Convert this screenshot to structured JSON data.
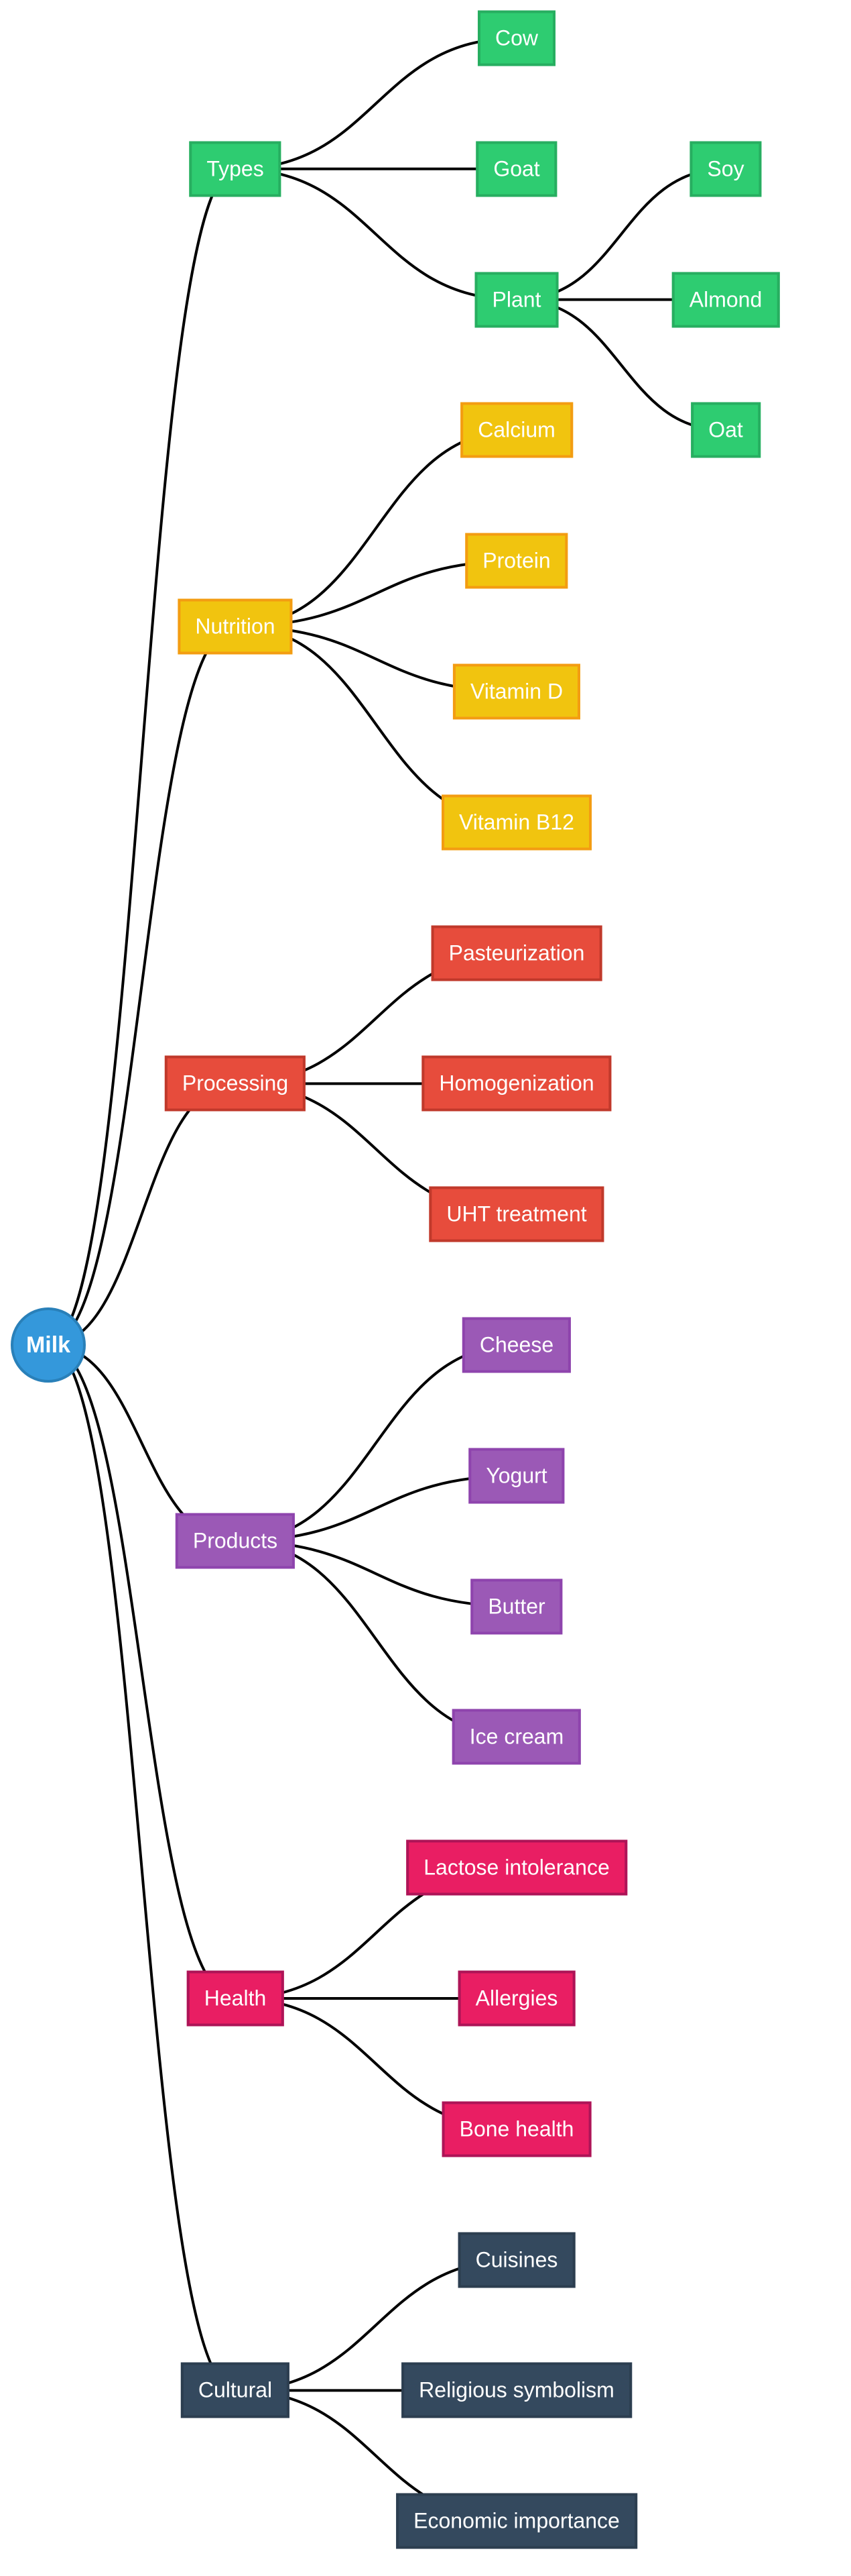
{
  "diagram": {
    "type": "mindmap",
    "root": {
      "label": "Milk",
      "color": {
        "fill": "#3498db",
        "border": "#2980b9"
      },
      "children": [
        {
          "label": "Types",
          "color": {
            "fill": "#2ecc71",
            "border": "#27ae60"
          },
          "children": [
            {
              "label": "Cow"
            },
            {
              "label": "Goat"
            },
            {
              "label": "Plant",
              "children": [
                {
                  "label": "Soy"
                },
                {
                  "label": "Almond"
                },
                {
                  "label": "Oat"
                }
              ]
            }
          ]
        },
        {
          "label": "Nutrition",
          "color": {
            "fill": "#f1c40f",
            "border": "#f39c12"
          },
          "children": [
            {
              "label": "Calcium"
            },
            {
              "label": "Protein"
            },
            {
              "label": "Vitamin D"
            },
            {
              "label": "Vitamin B12"
            }
          ]
        },
        {
          "label": "Processing",
          "color": {
            "fill": "#e74c3c",
            "border": "#c0392b"
          },
          "children": [
            {
              "label": "Pasteurization"
            },
            {
              "label": "Homogenization"
            },
            {
              "label": "UHT treatment"
            }
          ]
        },
        {
          "label": "Products",
          "color": {
            "fill": "#9b59b6",
            "border": "#8e44ad"
          },
          "children": [
            {
              "label": "Cheese"
            },
            {
              "label": "Yogurt"
            },
            {
              "label": "Butter"
            },
            {
              "label": "Ice cream"
            }
          ]
        },
        {
          "label": "Health",
          "color": {
            "fill": "#e91e63",
            "border": "#ad1457"
          },
          "children": [
            {
              "label": "Lactose intolerance"
            },
            {
              "label": "Allergies"
            },
            {
              "label": "Bone health"
            }
          ]
        },
        {
          "label": "Cultural",
          "color": {
            "fill": "#34495e",
            "border": "#2c3e50"
          },
          "children": [
            {
              "label": "Cuisines"
            },
            {
              "label": "Religious symbolism"
            },
            {
              "label": "Economic importance"
            }
          ]
        }
      ]
    },
    "link_color": "#000000"
  }
}
